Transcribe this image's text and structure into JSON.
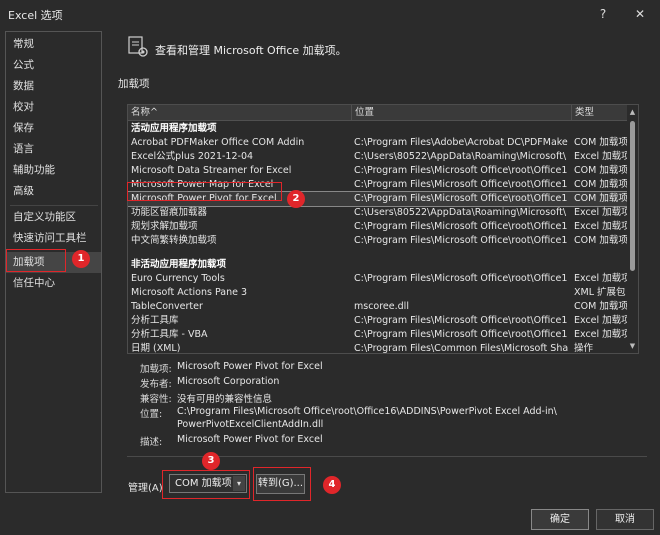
{
  "window": {
    "title": "Excel 选项",
    "help": "?",
    "close": "✕"
  },
  "sidebar": {
    "items": [
      {
        "label": "常规"
      },
      {
        "label": "公式"
      },
      {
        "label": "数据"
      },
      {
        "label": "校对"
      },
      {
        "label": "保存"
      },
      {
        "label": "语言"
      },
      {
        "label": "辅助功能"
      },
      {
        "label": "高级"
      },
      {
        "label": "自定义功能区"
      },
      {
        "label": "快速访问工具栏"
      },
      {
        "label": "加载项"
      },
      {
        "label": "信任中心"
      }
    ],
    "active": "加载项"
  },
  "header": {
    "title": "查看和管理 Microsoft Office 加载项。"
  },
  "addins": {
    "section_label": "加载项",
    "columns": [
      "名称^",
      "位置",
      "类型"
    ],
    "active_group": "活动应用程序加载项",
    "active_rows": [
      [
        "Acrobat PDFMaker Office COM Addin",
        "C:\\Program Files\\Adobe\\Acrobat DC\\PDFMake",
        "COM 加载项"
      ],
      [
        "Excel公式plus 2021-12-04",
        "C:\\Users\\80522\\AppData\\Roaming\\Microsoft\\",
        "Excel 加载项"
      ],
      [
        "Microsoft Data Streamer for Excel",
        "C:\\Program Files\\Microsoft Office\\root\\Office1",
        "COM 加载项"
      ],
      [
        "Microsoft Power Map for Excel",
        "C:\\Program Files\\Microsoft Office\\root\\Office1",
        "COM 加载项"
      ],
      [
        "Microsoft Power Pivot for Excel",
        "C:\\Program Files\\Microsoft Office\\root\\Office1",
        "COM 加载项"
      ],
      [
        "功能区留痕加载器",
        "C:\\Users\\80522\\AppData\\Roaming\\Microsoft\\",
        "Excel 加载项"
      ],
      [
        "规划求解加载项",
        "C:\\Program Files\\Microsoft Office\\root\\Office1",
        "Excel 加载项"
      ],
      [
        "中文简繁转换加载项",
        "C:\\Program Files\\Microsoft Office\\root\\Office1",
        "COM 加载项"
      ]
    ],
    "inactive_group": "非活动应用程序加载项",
    "inactive_rows": [
      [
        "Euro Currency Tools",
        "C:\\Program Files\\Microsoft Office\\root\\Office1",
        "Excel 加载项"
      ],
      [
        "Microsoft Actions Pane 3",
        "",
        "XML 扩展包"
      ],
      [
        "TableConverter",
        "mscoree.dll",
        "COM 加载项"
      ],
      [
        "分析工具库",
        "C:\\Program Files\\Microsoft Office\\root\\Office1",
        "Excel 加载项"
      ],
      [
        "分析工具库 - VBA",
        "C:\\Program Files\\Microsoft Office\\root\\Office1",
        "Excel 加载项"
      ],
      [
        "日期 (XML)",
        "C:\\Program Files\\Common Files\\Microsoft Shar",
        "操作"
      ]
    ]
  },
  "details": {
    "addin_label": "加载项:",
    "addin_value": "Microsoft Power Pivot for Excel",
    "publisher_label": "发布者:",
    "publisher_value": "Microsoft Corporation",
    "compat_label": "兼容性:",
    "compat_value": "没有可用的兼容性信息",
    "location_label": "位置:",
    "location_value1": "C:\\Program Files\\Microsoft Office\\root\\Office16\\ADDINS\\PowerPivot Excel Add-in\\",
    "location_value2": "PowerPivotExcelClientAddIn.dll",
    "desc_label": "描述:",
    "desc_value": "Microsoft Power Pivot for Excel"
  },
  "manage": {
    "label": "管理(A)",
    "selected": "COM 加载项",
    "goto": "转到(G)..."
  },
  "footer": {
    "ok": "确定",
    "cancel": "取消"
  },
  "annotations": {
    "b1": "1",
    "b2": "2",
    "b3": "3",
    "b4": "4"
  },
  "colors": {
    "highlight": "#e0262a",
    "background": "#2b2b2b"
  }
}
